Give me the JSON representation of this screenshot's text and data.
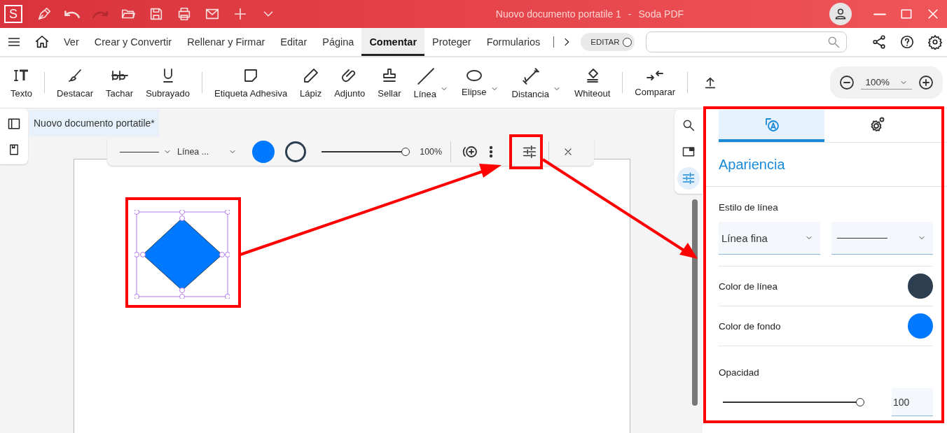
{
  "window": {
    "logo": "S",
    "title": "Nuovo documento portatile 1",
    "separator": "-",
    "app": "Soda PDF"
  },
  "menu_tabs": [
    {
      "label": "Ver",
      "selected": false
    },
    {
      "label": "Crear y Convertir",
      "selected": false
    },
    {
      "label": "Rellenar y Firmar",
      "selected": false
    },
    {
      "label": "Editar",
      "selected": false
    },
    {
      "label": "Página",
      "selected": false
    },
    {
      "label": "Comentar",
      "selected": true
    },
    {
      "label": "Proteger",
      "selected": false
    },
    {
      "label": "Formularios",
      "selected": false
    }
  ],
  "edit_toggle": {
    "label": "EDITAR",
    "on": false
  },
  "tool_groups": [
    [
      {
        "kind": "text",
        "label": "Texto",
        "dropdown": false
      }
    ],
    [
      {
        "kind": "highlight",
        "label": "Destacar",
        "dropdown": false
      },
      {
        "kind": "strike",
        "label": "Tachar",
        "dropdown": false
      },
      {
        "kind": "underline",
        "label": "Subrayado",
        "dropdown": false
      }
    ],
    [
      {
        "kind": "note",
        "label": "Etiqueta Adhesiva",
        "dropdown": false
      },
      {
        "kind": "pencil",
        "label": "Lápiz",
        "dropdown": false
      },
      {
        "kind": "clip",
        "label": "Adjunto",
        "dropdown": false
      },
      {
        "kind": "stamp",
        "label": "Sellar",
        "dropdown": false
      },
      {
        "kind": "line",
        "label": "Línea",
        "dropdown": true
      },
      {
        "kind": "ellipse",
        "label": "Elipse",
        "dropdown": true
      },
      {
        "kind": "measure",
        "label": "Distancia",
        "dropdown": true
      },
      {
        "kind": "eraser",
        "label": "Whiteout",
        "dropdown": false
      }
    ],
    [
      {
        "kind": "compare",
        "label": "Comparar",
        "dropdown": false
      }
    ]
  ],
  "zoom": {
    "value": "100%"
  },
  "document_tab": {
    "label": "Nuovo documento portatile*",
    "selected": true
  },
  "floating_toolbar": {
    "line_style": "Línea ...",
    "level": 1,
    "opacity": "100%"
  },
  "side_tools": [
    {
      "kind": "search",
      "selected": false
    },
    {
      "kind": "panel",
      "selected": false
    },
    {
      "kind": "sliders",
      "selected": true
    }
  ],
  "panel": {
    "tabs": [
      {
        "kind": "appearance",
        "selected": true
      },
      {
        "kind": "settings",
        "selected": false
      }
    ],
    "heading": "Apariencia",
    "line_style_label": "Estilo de línea",
    "line_weight": "Línea fina",
    "line_color": {
      "label": "Color de línea",
      "color": "#2c3e50"
    },
    "fill_color": {
      "label": "Color de fondo",
      "color": "#0078ff"
    },
    "opacity": {
      "label": "Opacidad",
      "level": 1,
      "value": "100"
    }
  }
}
